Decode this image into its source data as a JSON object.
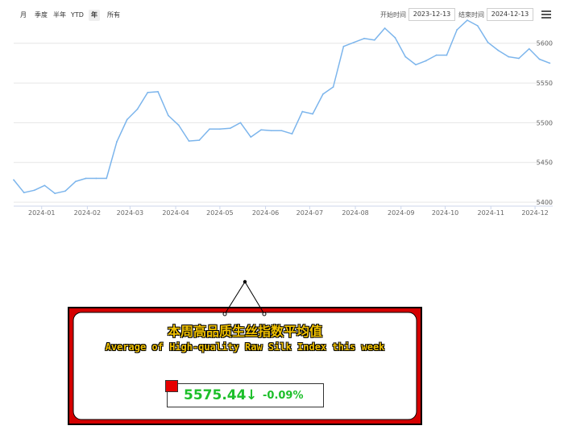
{
  "toolbar": {
    "ranges": [
      "月",
      "季度",
      "半年",
      "YTD",
      "年",
      "所有"
    ],
    "active_range": "年",
    "start_label": "开始时间",
    "start_value": "2023-12-13",
    "end_label": "结束时间",
    "end_value": "2024-12-13"
  },
  "colors": {
    "line": "#7cb5ec",
    "card_border": "#d40000",
    "card_title": "#f2c200",
    "down": "#1dbf2a",
    "marker": "#e60000"
  },
  "chart_data": {
    "type": "line",
    "title": "",
    "xlabel": "",
    "ylabel": "",
    "x_ticks": [
      "2024-01",
      "2024-02",
      "2024-03",
      "2024-04",
      "2024-05",
      "2024-06",
      "2024-07",
      "2024-08",
      "2024-09",
      "2024-10",
      "2024-11",
      "2024-12"
    ],
    "y_ticks": [
      5400,
      5450,
      5500,
      5550,
      5600
    ],
    "ylim": [
      5395,
      5620
    ],
    "xlim": [
      "2023-12-13",
      "2024-12-13"
    ],
    "grid": true,
    "series": [
      {
        "x": [
          "2023-12-13",
          "2023-12-20",
          "2023-12-27",
          "2024-01-03",
          "2024-01-10",
          "2024-01-17",
          "2024-01-24",
          "2024-01-31",
          "2024-02-07",
          "2024-02-14",
          "2024-02-21",
          "2024-02-28",
          "2024-03-06",
          "2024-03-13",
          "2024-03-20",
          "2024-03-27",
          "2024-04-03",
          "2024-04-10",
          "2024-04-17",
          "2024-04-24",
          "2024-05-01",
          "2024-05-08",
          "2024-05-15",
          "2024-05-22",
          "2024-05-29",
          "2024-06-05",
          "2024-06-12",
          "2024-06-19",
          "2024-06-26",
          "2024-07-03",
          "2024-07-10",
          "2024-07-17",
          "2024-07-24",
          "2024-07-31",
          "2024-08-07",
          "2024-08-14",
          "2024-08-21",
          "2024-08-28",
          "2024-09-04",
          "2024-09-11",
          "2024-09-18",
          "2024-09-25",
          "2024-10-02",
          "2024-10-09",
          "2024-10-16",
          "2024-10-23",
          "2024-10-30",
          "2024-11-06",
          "2024-11-13",
          "2024-11-20",
          "2024-11-27",
          "2024-12-04",
          "2024-12-11"
        ],
        "y": [
          5428,
          5412,
          5415,
          5421,
          5411,
          5414,
          5426,
          5430,
          5430,
          5430,
          5476,
          5504,
          5517,
          5538,
          5539,
          5509,
          5497,
          5477,
          5478,
          5492,
          5492,
          5493,
          5500,
          5482,
          5491,
          5490,
          5490,
          5486,
          5514,
          5511,
          5536,
          5545,
          5596,
          5601,
          5606,
          5604,
          5619,
          5607,
          5583,
          5573,
          5578,
          5585,
          5585,
          5617,
          5629,
          5622,
          5601,
          5591,
          5583,
          5581,
          5593,
          5580,
          5575
        ]
      }
    ]
  },
  "card": {
    "title_cn": "本周高品质生丝指数平均值",
    "title_en": "Average of High-quality Raw Silk Index this week",
    "value": "5575.44",
    "arrow": "↓",
    "change": "-0.09%"
  }
}
